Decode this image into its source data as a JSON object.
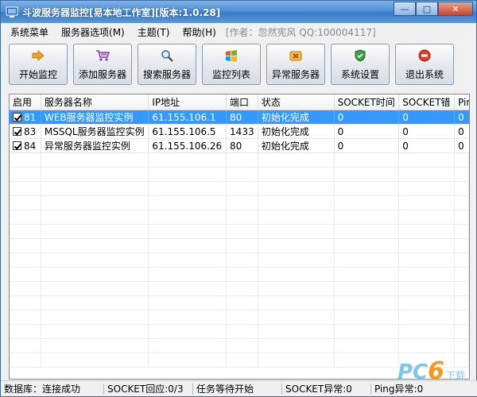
{
  "window": {
    "title": "斗波服务器监控[易本地工作室][版本:1.0.28]",
    "controls": {
      "minimize": "—",
      "maximize": "□",
      "close": "✕"
    }
  },
  "menu": {
    "items": [
      "系统菜单",
      "服务器选项(M)",
      "主题(T)",
      "帮助(H)"
    ],
    "author": "[作者：忽然宪风 QQ:100004117]"
  },
  "toolbar": {
    "buttons": [
      {
        "label": "开始监控",
        "icon": "arrow-right-icon"
      },
      {
        "label": "添加服务器",
        "icon": "cart-icon"
      },
      {
        "label": "搜索服务器",
        "icon": "magnifier-icon"
      },
      {
        "label": "监控列表",
        "icon": "windows-flag-icon"
      },
      {
        "label": "异常服务器",
        "icon": "warning-server-icon"
      },
      {
        "label": "系统设置",
        "icon": "shield-icon"
      },
      {
        "label": "退出系统",
        "icon": "stop-icon"
      }
    ]
  },
  "table": {
    "headers": [
      "启用",
      "服务器名称",
      "IP地址",
      "端口",
      "状态",
      "SOCKET时间",
      "SOCKET错",
      "Pin"
    ],
    "rows": [
      {
        "enabled": true,
        "id": "81",
        "name": "WEB服务器监控实例",
        "ip": "61.155.106.1",
        "port": "80",
        "status": "初始化完成",
        "socket_time": "0",
        "socket_err": "0",
        "ping": "0",
        "selected": true
      },
      {
        "enabled": true,
        "id": "83",
        "name": "MSSQL服务器监控实例",
        "ip": "61.155.106.5",
        "port": "1433",
        "status": "初始化完成",
        "socket_time": "0",
        "socket_err": "0",
        "ping": "0",
        "selected": false
      },
      {
        "enabled": true,
        "id": "84",
        "name": "异常服务器监控实例",
        "ip": "61.155.106.26",
        "port": "80",
        "status": "初始化完成",
        "socket_time": "0",
        "socket_err": "0",
        "ping": "0",
        "selected": false
      }
    ]
  },
  "status": {
    "database": "数据库：连接成功",
    "socket_reply": "SOCKET回应:0/3",
    "task": "任务等待开始",
    "socket_error": "SOCKET异常:0",
    "ping_error": "Ping异常:0"
  },
  "watermark": {
    "pc": "PC",
    "six": "6",
    "sub": "下载"
  },
  "colors": {
    "selection": "#3399ff",
    "title_gradient_top": "#7fb2e6",
    "title_gradient_bottom": "#3a7bc8"
  }
}
